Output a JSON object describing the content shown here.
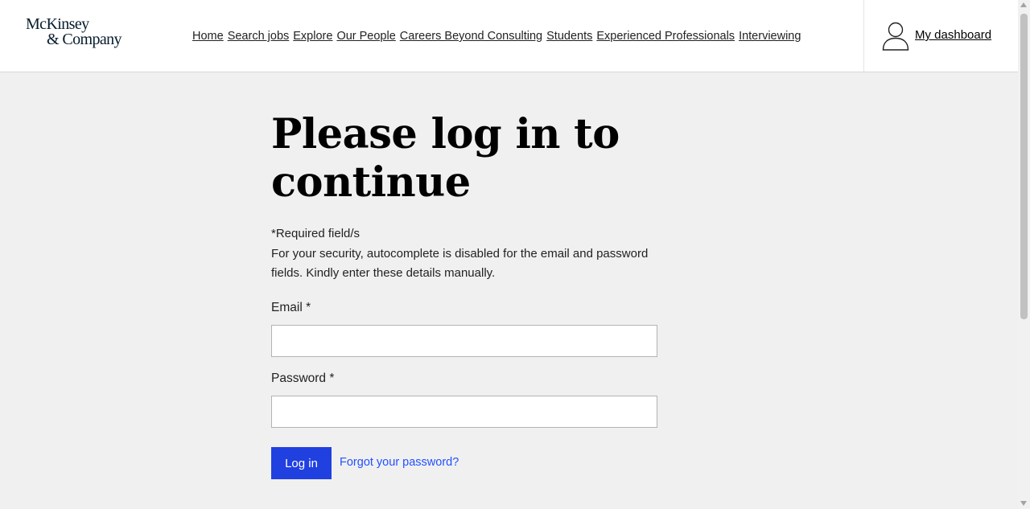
{
  "logo": {
    "line1": "McKinsey",
    "line2": "& Company"
  },
  "nav": {
    "items": [
      {
        "label": "Home"
      },
      {
        "label": "Search jobs"
      },
      {
        "label": "Explore"
      },
      {
        "label": "Our People"
      },
      {
        "label": "Careers Beyond Consulting"
      },
      {
        "label": "Students"
      },
      {
        "label": "Experienced Professionals"
      },
      {
        "label": "Interviewing"
      }
    ]
  },
  "account": {
    "label": " My dashboard",
    "icon": "user-icon"
  },
  "form": {
    "title": "Please log in to continue",
    "required_note": "*Required field/s",
    "security_note": "For your security, autocomplete is disabled for the email and password fields. Kindly enter these details manually.",
    "email_label": "Email *",
    "email_value": "",
    "password_label": "Password *",
    "password_value": "",
    "login_label": "Log in",
    "forgot_label": "Forgot your password?"
  },
  "colors": {
    "accent": "#2140e0",
    "link": "#2251ff",
    "page_bg": "#f0f0f0",
    "logo": "#051c2c"
  }
}
